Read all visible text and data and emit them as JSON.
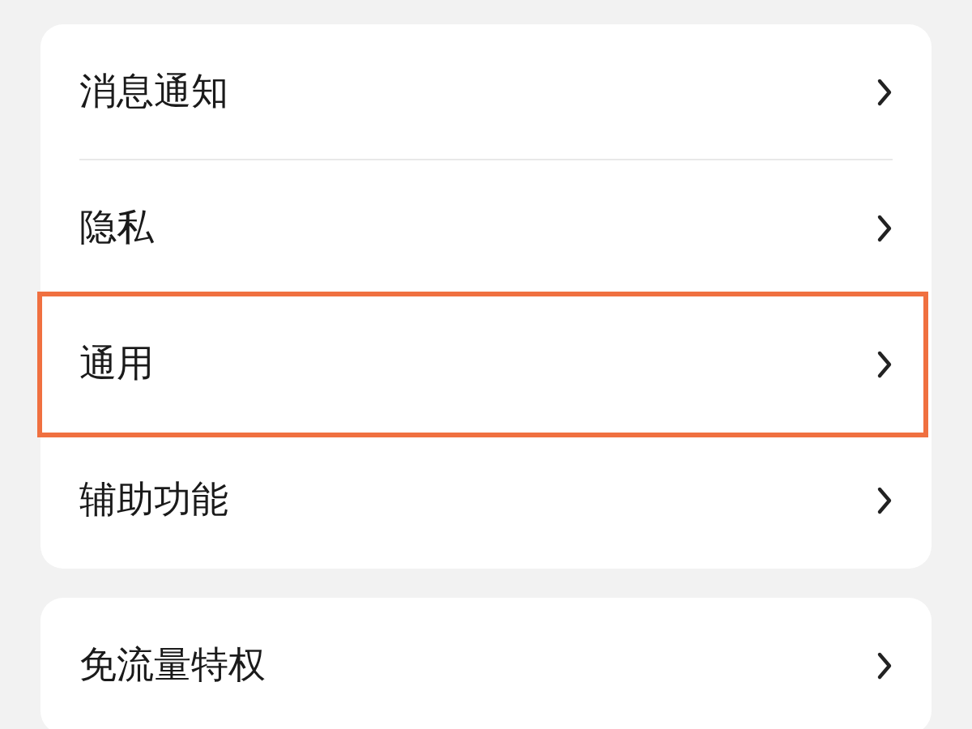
{
  "groups": [
    {
      "items": [
        {
          "label": "消息通知",
          "highlighted": false,
          "divider_below": true
        },
        {
          "label": "隐私",
          "highlighted": false,
          "divider_below": false
        },
        {
          "label": "通用",
          "highlighted": true,
          "divider_below": false
        },
        {
          "label": "辅助功能",
          "highlighted": false,
          "divider_below": false
        }
      ]
    },
    {
      "items": [
        {
          "label": "免流量特权",
          "highlighted": false,
          "divider_below": false
        }
      ]
    }
  ]
}
